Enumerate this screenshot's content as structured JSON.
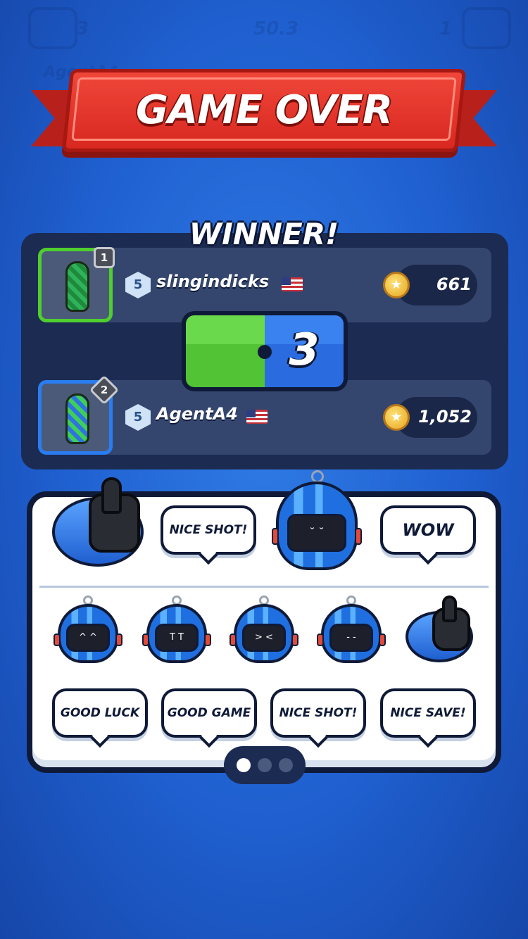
{
  "background_hud": {
    "left_score": "3",
    "timer": "50.3",
    "right_score": "1",
    "player_tag": "AgentA4"
  },
  "banner": {
    "title": "GAME OVER"
  },
  "results": {
    "winner_label": "WINNER!",
    "score_left": "",
    "score_right": "3",
    "players": [
      {
        "rank": "1",
        "level": "5",
        "name": "slingindicks",
        "flag": "US",
        "coins": "661",
        "team_color": "#4fcf2e"
      },
      {
        "rank": "2",
        "level": "5",
        "name": "AgentA4",
        "flag": "US",
        "coins": "1,052",
        "team_color": "#2a7df0"
      }
    ]
  },
  "emotes": {
    "row1": [
      {
        "type": "thumbs-up-icon"
      },
      {
        "type": "speech",
        "label": "NICE SHOT!"
      },
      {
        "type": "helmet-shy-icon"
      },
      {
        "type": "speech",
        "label": "WOW"
      }
    ],
    "row2_icons": [
      "helmet-laugh-icon",
      "helmet-cry-icon",
      "helmet-shout-icon",
      "helmet-blush-icon",
      "thumbs-up-icon"
    ],
    "row3": [
      {
        "label": "GOOD LUCK"
      },
      {
        "label": "GOOD GAME"
      },
      {
        "label": "NICE SHOT!"
      },
      {
        "label": "NICE SAVE!"
      }
    ]
  },
  "pager": {
    "pages": 3,
    "active": 1
  },
  "colors": {
    "green_team": "#52c334",
    "blue_team": "#2a6be0",
    "banner_red": "#d8281f",
    "panel_dark": "#1c2b52"
  }
}
